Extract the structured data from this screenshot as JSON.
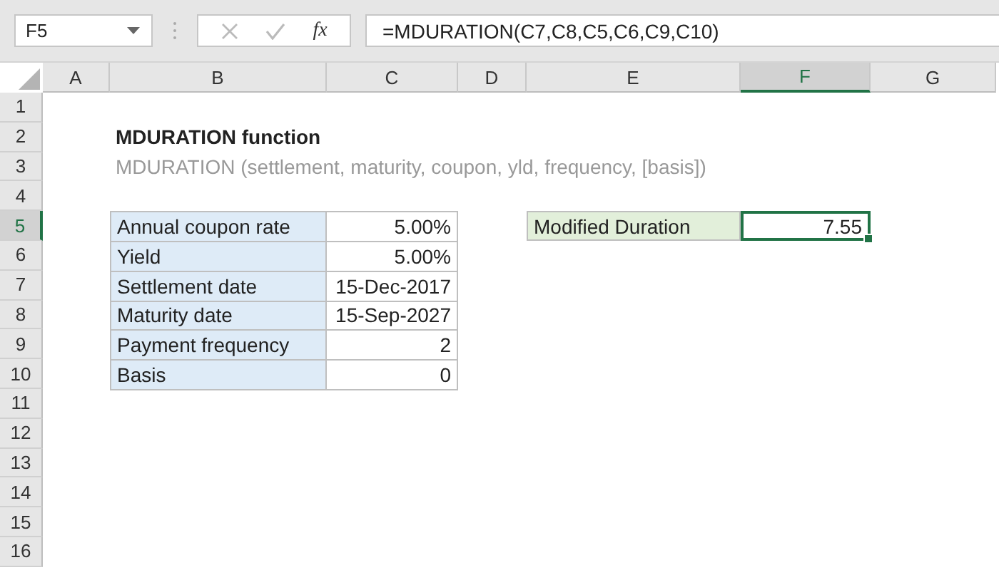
{
  "name_box": {
    "value": "F5"
  },
  "formula_bar": {
    "function_label": "fx",
    "formula": "=MDURATION(C7,C8,C5,C6,C9,C10)"
  },
  "columns": [
    {
      "label": "A",
      "selected": false
    },
    {
      "label": "B",
      "selected": false
    },
    {
      "label": "C",
      "selected": false
    },
    {
      "label": "D",
      "selected": false
    },
    {
      "label": "E",
      "selected": false
    },
    {
      "label": "F",
      "selected": true
    },
    {
      "label": "G",
      "selected": false
    }
  ],
  "rows": [
    {
      "number": "1",
      "selected": false,
      "cells": {}
    },
    {
      "number": "2",
      "selected": false,
      "cells": {
        "B": {
          "kind": "title",
          "text": "MDURATION function"
        }
      }
    },
    {
      "number": "3",
      "selected": false,
      "cells": {
        "B": {
          "kind": "subtitle",
          "text": "MDURATION (settlement, maturity, coupon, yld, frequency, [basis])"
        }
      }
    },
    {
      "number": "4",
      "selected": false,
      "cells": {}
    },
    {
      "number": "5",
      "selected": true,
      "cells": {
        "B": {
          "kind": "label",
          "text": "Annual coupon rate"
        },
        "C": {
          "kind": "value",
          "text": "5.00%"
        },
        "E": {
          "kind": "result_label",
          "text": "Modified Duration"
        },
        "F": {
          "kind": "result_value",
          "text": "7.55",
          "selected": true
        }
      }
    },
    {
      "number": "6",
      "selected": false,
      "cells": {
        "B": {
          "kind": "label",
          "text": "Yield"
        },
        "C": {
          "kind": "value",
          "text": "5.00%"
        }
      }
    },
    {
      "number": "7",
      "selected": false,
      "cells": {
        "B": {
          "kind": "label",
          "text": "Settlement date"
        },
        "C": {
          "kind": "value",
          "text": "15-Dec-2017"
        }
      }
    },
    {
      "number": "8",
      "selected": false,
      "cells": {
        "B": {
          "kind": "label",
          "text": "Maturity date"
        },
        "C": {
          "kind": "value",
          "text": "15-Sep-2027"
        }
      }
    },
    {
      "number": "9",
      "selected": false,
      "cells": {
        "B": {
          "kind": "label",
          "text": "Payment frequency"
        },
        "C": {
          "kind": "value",
          "text": "2"
        }
      }
    },
    {
      "number": "10",
      "selected": false,
      "cells": {
        "B": {
          "kind": "label",
          "text": "Basis"
        },
        "C": {
          "kind": "value",
          "text": "0"
        }
      }
    },
    {
      "number": "11",
      "selected": false,
      "cells": {}
    },
    {
      "number": "12",
      "selected": false,
      "cells": {}
    },
    {
      "number": "13",
      "selected": false,
      "cells": {}
    },
    {
      "number": "14",
      "selected": false,
      "cells": {}
    },
    {
      "number": "15",
      "selected": false,
      "cells": {}
    },
    {
      "number": "16",
      "selected": false,
      "cells": {}
    }
  ]
}
